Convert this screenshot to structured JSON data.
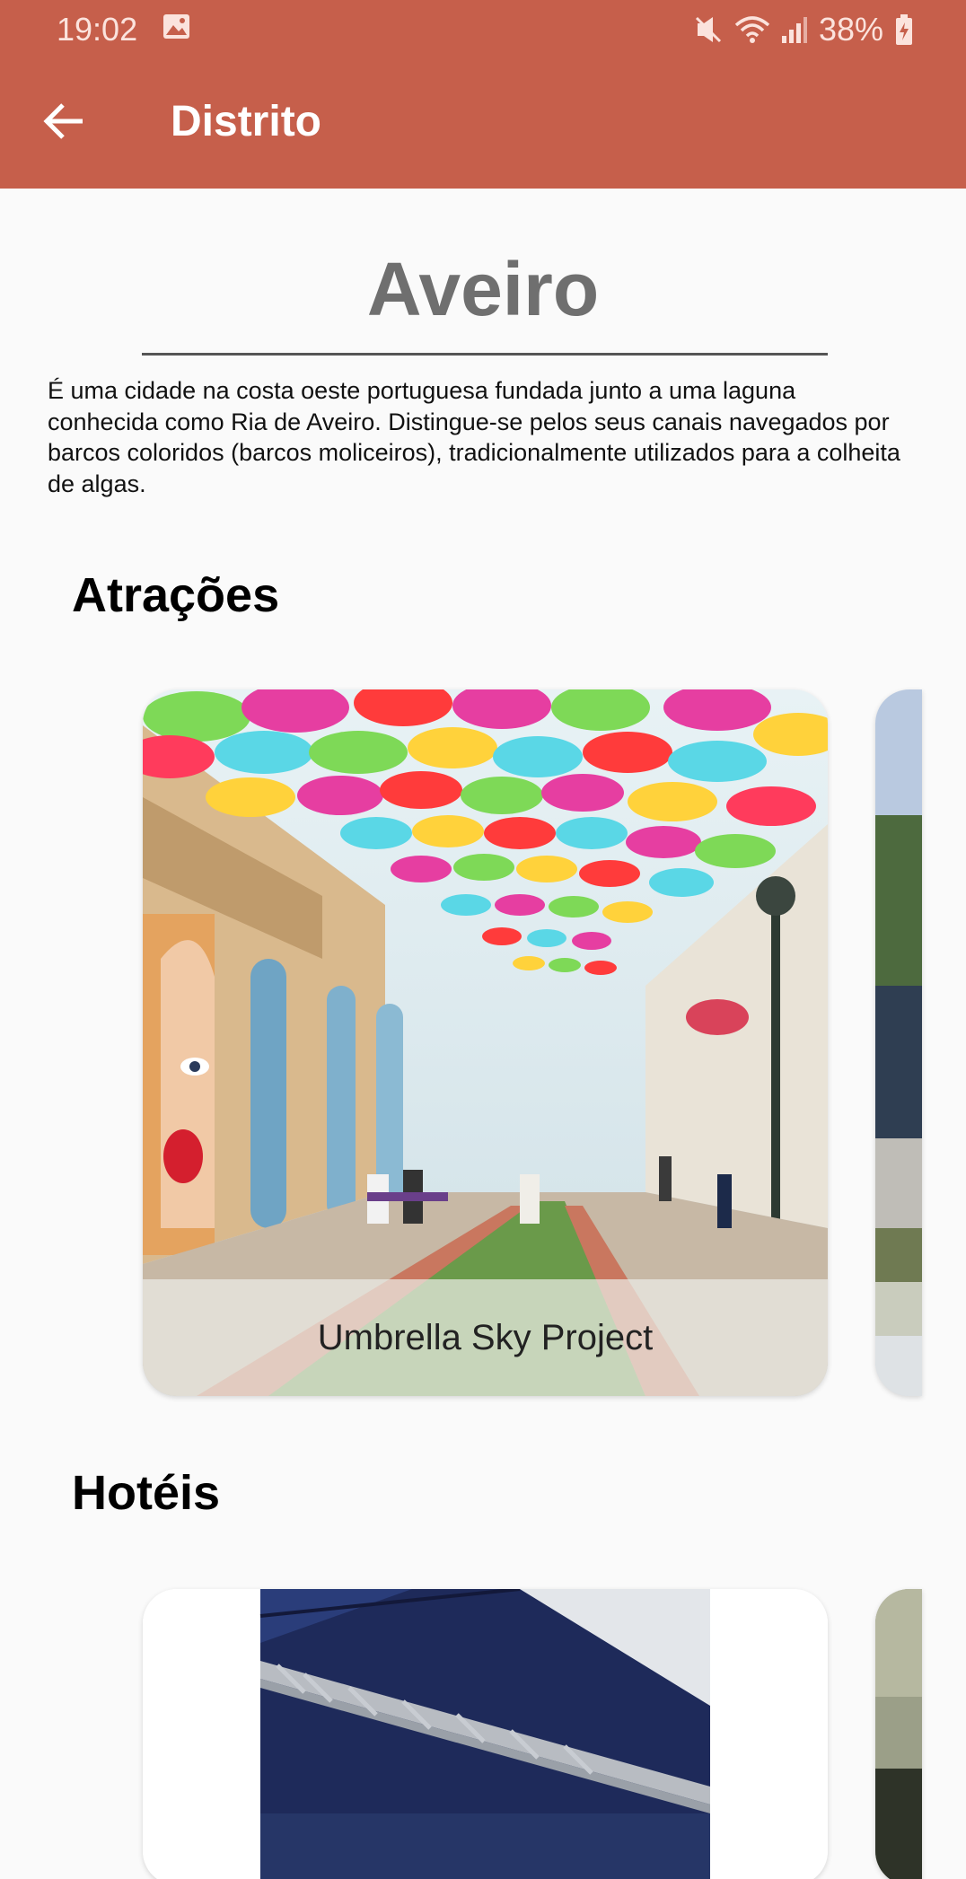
{
  "status_bar": {
    "time": "19:02",
    "battery": "38%",
    "icons": [
      "image-icon",
      "mute-icon",
      "wifi-icon",
      "signal-icon",
      "battery-charging-icon"
    ]
  },
  "app_bar": {
    "back_icon": "arrow-back-icon",
    "title": "Distrito"
  },
  "district": {
    "name": "Aveiro",
    "description": "É uma cidade na costa oeste portuguesa fundada junto a uma laguna conhecida como Ria de Aveiro. Distingue-se pelos seus canais navegados por barcos coloridos (barcos moliceiros), tradicionalmente utilizados para a colheita de algas."
  },
  "sections": {
    "attractions": {
      "title": "Atrações",
      "cards": [
        {
          "caption": "Umbrella Sky Project"
        }
      ]
    },
    "hotels": {
      "title": "Hotéis"
    }
  },
  "colors": {
    "app_bar": "#c65f4b",
    "background": "#fafafa",
    "title_gray": "#6f6f6f"
  }
}
